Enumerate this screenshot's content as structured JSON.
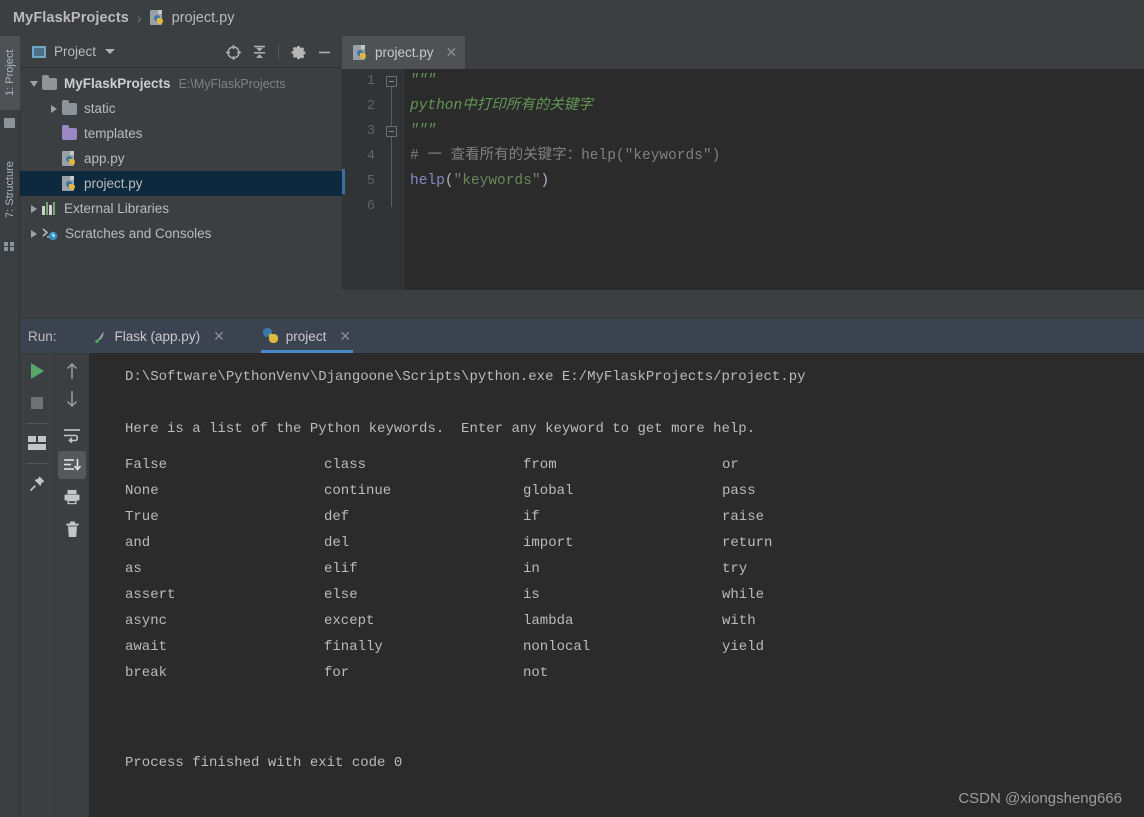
{
  "breadcrumb": {
    "project": "MyFlaskProjects",
    "separator": "›",
    "file": "project.py",
    "file_icon": "python-file-icon"
  },
  "tool_strip": {
    "tabs": [
      {
        "label": "1: Project",
        "active": true
      },
      {
        "label": "7: Structure",
        "active": false
      }
    ]
  },
  "project_panel": {
    "title": "Project",
    "dropdown_icon": "chevron-down-icon",
    "window_icon": "project-window-icon",
    "toolbar": [
      {
        "name": "locate-icon",
        "label": "Select Opened File"
      },
      {
        "name": "collapse-all-icon",
        "label": "Collapse All"
      },
      {
        "name": "gear-icon",
        "label": "Settings"
      },
      {
        "name": "minimize-icon",
        "label": "Hide"
      }
    ],
    "tree": [
      {
        "label": "MyFlaskProjects",
        "path": "E:\\MyFlaskProjects",
        "icon": "folder-icon",
        "arrow": "down",
        "depth": 0,
        "bold": true,
        "selected": false
      },
      {
        "label": "static",
        "path": "",
        "icon": "folder-icon",
        "arrow": "right",
        "depth": 1,
        "bold": false,
        "selected": false
      },
      {
        "label": "templates",
        "path": "",
        "icon": "folder-purple-icon",
        "arrow": "none",
        "depth": 1,
        "bold": false,
        "selected": false
      },
      {
        "label": "app.py",
        "path": "",
        "icon": "python-file-icon",
        "arrow": "none",
        "depth": 1,
        "bold": false,
        "selected": false
      },
      {
        "label": "project.py",
        "path": "",
        "icon": "python-file-icon",
        "arrow": "none",
        "depth": 1,
        "bold": false,
        "selected": true
      },
      {
        "label": "External Libraries",
        "path": "",
        "icon": "libraries-icon",
        "arrow": "right",
        "depth": 0,
        "bold": false,
        "selected": false
      },
      {
        "label": "Scratches and Consoles",
        "path": "",
        "icon": "scratches-icon",
        "arrow": "right",
        "depth": 0,
        "bold": false,
        "selected": false
      }
    ]
  },
  "editor": {
    "tab": {
      "label": "project.py",
      "icon": "python-file-icon",
      "close_icon": "close-icon"
    },
    "lines": [
      {
        "num": "1",
        "fold": "start",
        "segments": [
          {
            "text": "\"\"\"",
            "style": "doc"
          }
        ]
      },
      {
        "num": "2",
        "fold": "none",
        "segments": [
          {
            "text": "python中打印所有的关键字",
            "style": "doc"
          }
        ]
      },
      {
        "num": "3",
        "fold": "end",
        "segments": [
          {
            "text": "\"\"\"",
            "style": "doc"
          }
        ]
      },
      {
        "num": "4",
        "fold": "none",
        "segments": [
          {
            "text": "# 一 查看所有的关键字：help(\"keywords\")",
            "style": "comment"
          }
        ]
      },
      {
        "num": "5",
        "fold": "none",
        "segments": [
          {
            "text": "help",
            "style": "function"
          },
          {
            "text": "(",
            "style": "punct"
          },
          {
            "text": "\"keywords\"",
            "style": "string"
          },
          {
            "text": ")",
            "style": "punct"
          }
        ]
      },
      {
        "num": "6",
        "fold": "none",
        "segments": [
          {
            "text": "",
            "style": "punct"
          }
        ]
      }
    ],
    "caret_line": "5"
  },
  "run_panel": {
    "label": "Run:",
    "tabs": [
      {
        "label": "Flask (app.py)",
        "icon": "flask-icon",
        "active": false,
        "close_icon": "close-icon"
      },
      {
        "label": "project",
        "icon": "python-logo-icon",
        "active": true,
        "close_icon": "close-icon"
      }
    ],
    "toolbar_left": [
      {
        "name": "rerun-icon",
        "label": "Rerun"
      },
      {
        "name": "stop-icon",
        "label": "Stop"
      },
      {
        "name": "restore-layout-icon",
        "label": "Restore Layout"
      },
      {
        "name": "pin-tab-icon",
        "label": "Pin Tab"
      }
    ],
    "toolbar_right": [
      {
        "name": "up-arrow-icon",
        "label": "Up the Stack Trace"
      },
      {
        "name": "down-arrow-icon",
        "label": "Down the Stack Trace"
      },
      {
        "name": "soft-wrap-icon",
        "label": "Use Soft Wraps"
      },
      {
        "name": "scroll-to-end-icon",
        "label": "Scroll to End",
        "highlighted": true
      },
      {
        "name": "print-icon",
        "label": "Print"
      },
      {
        "name": "trash-icon",
        "label": "Clear All"
      }
    ],
    "console": {
      "command": "D:\\Software\\PythonVenv\\Djangoone\\Scripts\\python.exe E:/MyFlaskProjects/project.py",
      "header": "Here is a list of the Python keywords.  Enter any keyword to get more help.",
      "columns": [
        [
          "False",
          "None",
          "True",
          "and",
          "as",
          "assert",
          "async",
          "await",
          "break"
        ],
        [
          "class",
          "continue",
          "def",
          "del",
          "elif",
          "else",
          "except",
          "finally",
          "for"
        ],
        [
          "from",
          "global",
          "if",
          "import",
          "in",
          "is",
          "lambda",
          "nonlocal",
          "not"
        ],
        [
          "or",
          "pass",
          "raise",
          "return",
          "try",
          "while",
          "with",
          "yield",
          ""
        ]
      ],
      "exit_message": "Process finished with exit code 0"
    }
  },
  "watermark": "CSDN @xiongsheng666",
  "colors": {
    "chrome": "#3c3f41",
    "editor_bg": "#2b2b2b",
    "panel_header": "#3c4350",
    "selection": "#0d293e",
    "accent": "#4a88c7",
    "run_green": "#59a869",
    "doc_string": "#629755",
    "comment": "#808080",
    "function": "#8888c6"
  }
}
